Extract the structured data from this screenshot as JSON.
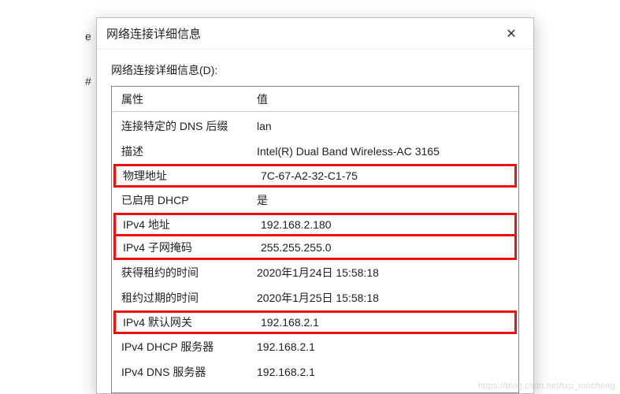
{
  "bg": {
    "char1": "e",
    "char2": "#"
  },
  "dialog": {
    "title": "网络连接详细信息",
    "close_glyph": "✕",
    "section_label": "网络连接详细信息(D):",
    "columns": {
      "prop": "属性",
      "val": "值"
    },
    "rows": [
      {
        "prop": "连接特定的 DNS 后缀",
        "val": "lan",
        "hl": false
      },
      {
        "prop": "描述",
        "val": "Intel(R) Dual Band Wireless-AC 3165",
        "hl": false
      },
      {
        "prop": "物理地址",
        "val": "7C-67-A2-32-C1-75",
        "hl": true
      },
      {
        "prop": "已启用 DHCP",
        "val": "是",
        "hl": false
      },
      {
        "prop": "IPv4 地址",
        "val": "192.168.2.180",
        "hl": true
      },
      {
        "prop": "IPv4 子网掩码",
        "val": "255.255.255.0",
        "hl": true
      },
      {
        "prop": "获得租约的时间",
        "val": "2020年1月24日 15:58:18",
        "hl": false
      },
      {
        "prop": "租约过期的时间",
        "val": "2020年1月25日 15:58:18",
        "hl": false
      },
      {
        "prop": "IPv4 默认网关",
        "val": "192.168.2.1",
        "hl": true
      },
      {
        "prop": "IPv4 DHCP 服务器",
        "val": "192.168.2.1",
        "hl": false
      },
      {
        "prop": "IPv4 DNS 服务器",
        "val": "192.168.2.1",
        "hl": false
      }
    ]
  },
  "watermark": "https://blog.csdn.net/txp_mocheng"
}
